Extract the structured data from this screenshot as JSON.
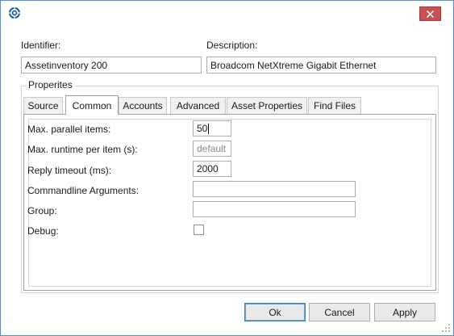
{
  "dialog": {
    "identifier_label": "Identifier:",
    "identifier_value": "Assetinventory 200",
    "description_label": "Description:",
    "description_value": "Broadcom NetXtreme Gigabit Ethernet",
    "group_title": "Properites"
  },
  "tabs": [
    {
      "label": "Source",
      "active": false
    },
    {
      "label": "Common",
      "active": true
    },
    {
      "label": "Accounts",
      "active": false
    },
    {
      "label": "Advanced",
      "active": false
    },
    {
      "label": "Asset Properties",
      "active": false
    },
    {
      "label": "Find Files",
      "active": false
    }
  ],
  "properties": {
    "max_parallel_label": "Max. parallel items:",
    "max_parallel_value": "50",
    "max_runtime_label": "Max. runtime per item (s):",
    "max_runtime_placeholder": "default",
    "reply_timeout_label": "Reply timeout (ms):",
    "reply_timeout_value": "2000",
    "commandline_label": "Commandline Arguments:",
    "commandline_value": "",
    "group_label": "Group:",
    "group_value": "",
    "debug_label": "Debug:",
    "debug_checked": false
  },
  "buttons": {
    "ok": "Ok",
    "cancel": "Cancel",
    "apply": "Apply"
  },
  "colors": {
    "close_button": "#c75050",
    "window_border": "#4a90d9",
    "app_icon": "#1f5f9f"
  },
  "icons": {
    "app": "app-logo-icon",
    "close": "close-icon",
    "resize": "resize-grip-icon"
  }
}
